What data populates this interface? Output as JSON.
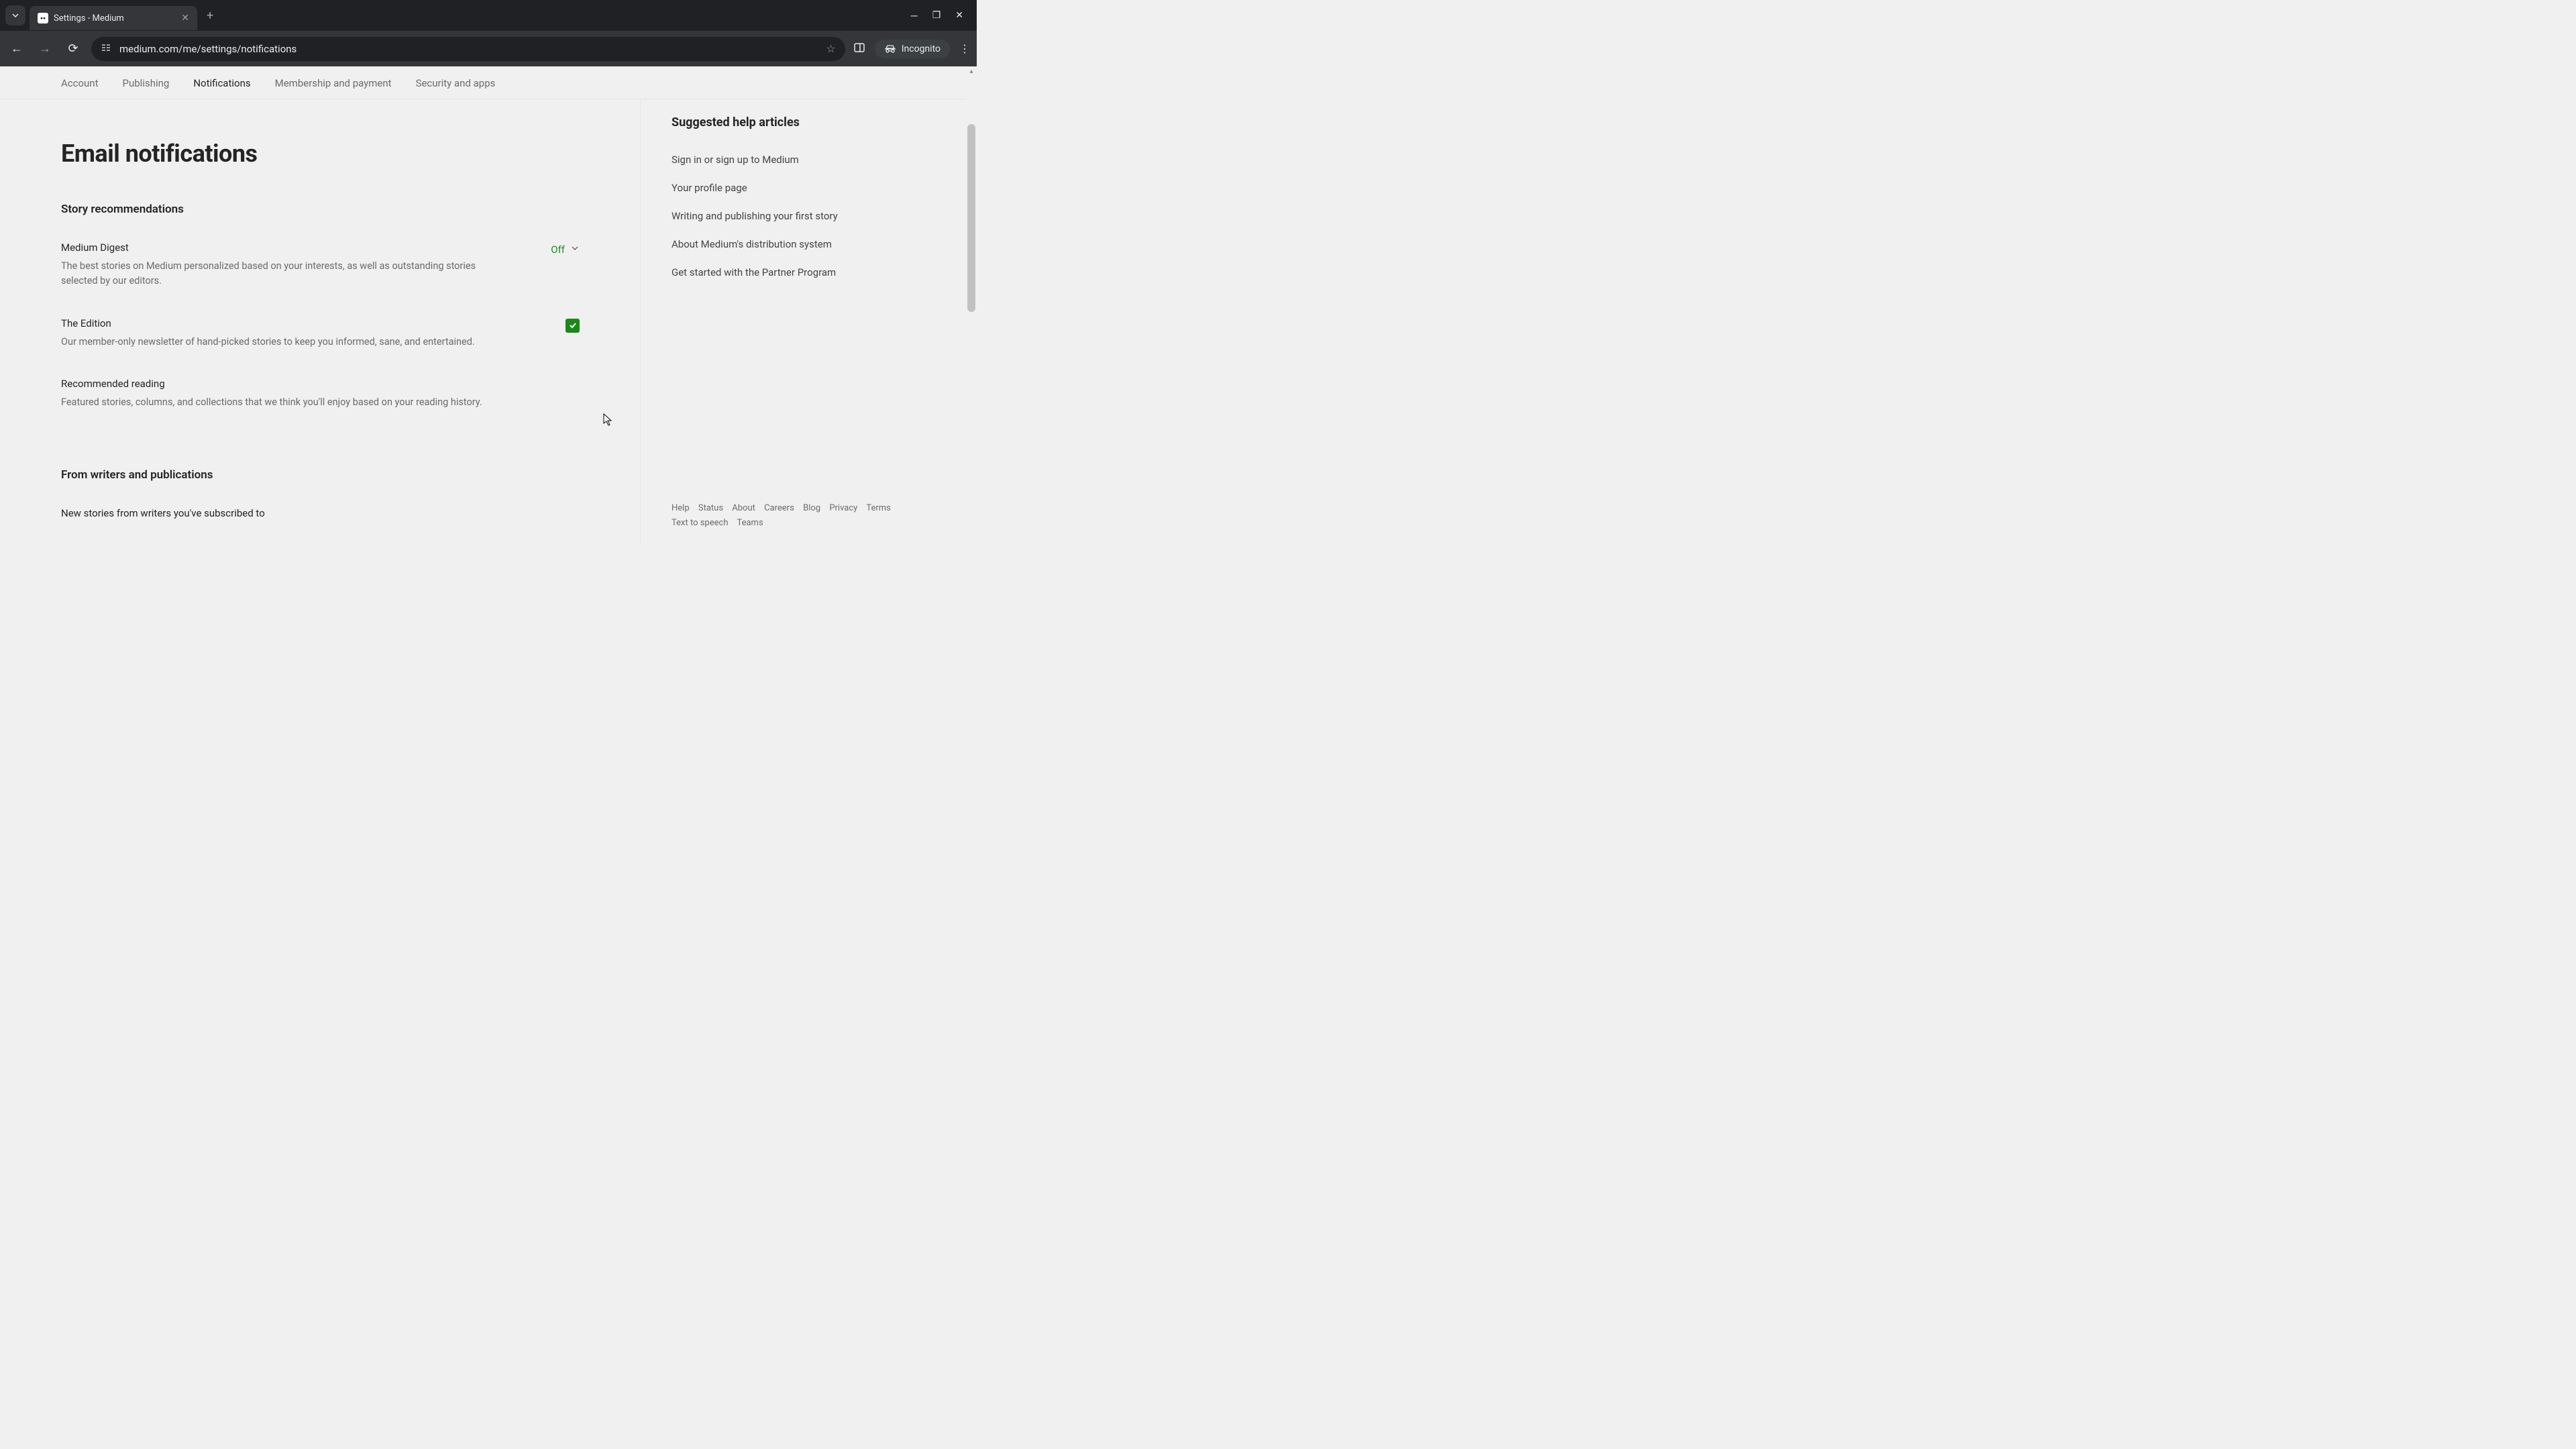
{
  "browser": {
    "tab_title": "Settings - Medium",
    "url": "medium.com/me/settings/notifications",
    "incognito_label": "Incognito"
  },
  "tabs": {
    "account": "Account",
    "publishing": "Publishing",
    "notifications": "Notifications",
    "membership": "Membership and payment",
    "security": "Security and apps"
  },
  "main": {
    "title": "Email notifications",
    "section_story": "Story recommendations",
    "digest": {
      "label": "Medium Digest",
      "desc": "The best stories on Medium personalized based on your interests, as well as outstanding stories selected by our editors.",
      "value": "Off"
    },
    "edition": {
      "label": "The Edition",
      "desc": "Our member-only newsletter of hand-picked stories to keep you informed, sane, and entertained."
    },
    "recommended": {
      "label": "Recommended reading",
      "desc": "Featured stories, columns, and collections that we think you'll enjoy based on your reading history."
    },
    "section_writers": "From writers and publications",
    "new_stories": {
      "label": "New stories from writers you've subscribed to"
    }
  },
  "sidebar": {
    "heading": "Suggested help articles",
    "links": {
      "signin": "Sign in or sign up to Medium",
      "profile": "Your profile page",
      "writing": "Writing and publishing your first story",
      "distribution": "About Medium's distribution system",
      "partner": "Get started with the Partner Program"
    }
  },
  "footer": {
    "help": "Help",
    "status": "Status",
    "about": "About",
    "careers": "Careers",
    "blog": "Blog",
    "privacy": "Privacy",
    "terms": "Terms",
    "tts": "Text to speech",
    "teams": "Teams"
  }
}
